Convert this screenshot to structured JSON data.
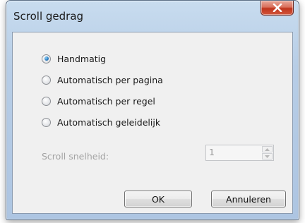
{
  "dialog": {
    "title": "Scroll gedrag",
    "close_label": "close"
  },
  "options": [
    {
      "label": "Handmatig",
      "checked": true
    },
    {
      "label": "Automatisch per pagina",
      "checked": false
    },
    {
      "label": "Automatisch per regel",
      "checked": false
    },
    {
      "label": "Automatisch geleidelijk",
      "checked": false
    }
  ],
  "speed": {
    "label": "Scroll snelheid:",
    "value": "1",
    "enabled": false
  },
  "buttons": {
    "ok": "OK",
    "cancel": "Annuleren"
  },
  "colors": {
    "accent_radio": "#2c7fc4",
    "close_button": "#c0341d",
    "frame": "#b7cde6"
  }
}
